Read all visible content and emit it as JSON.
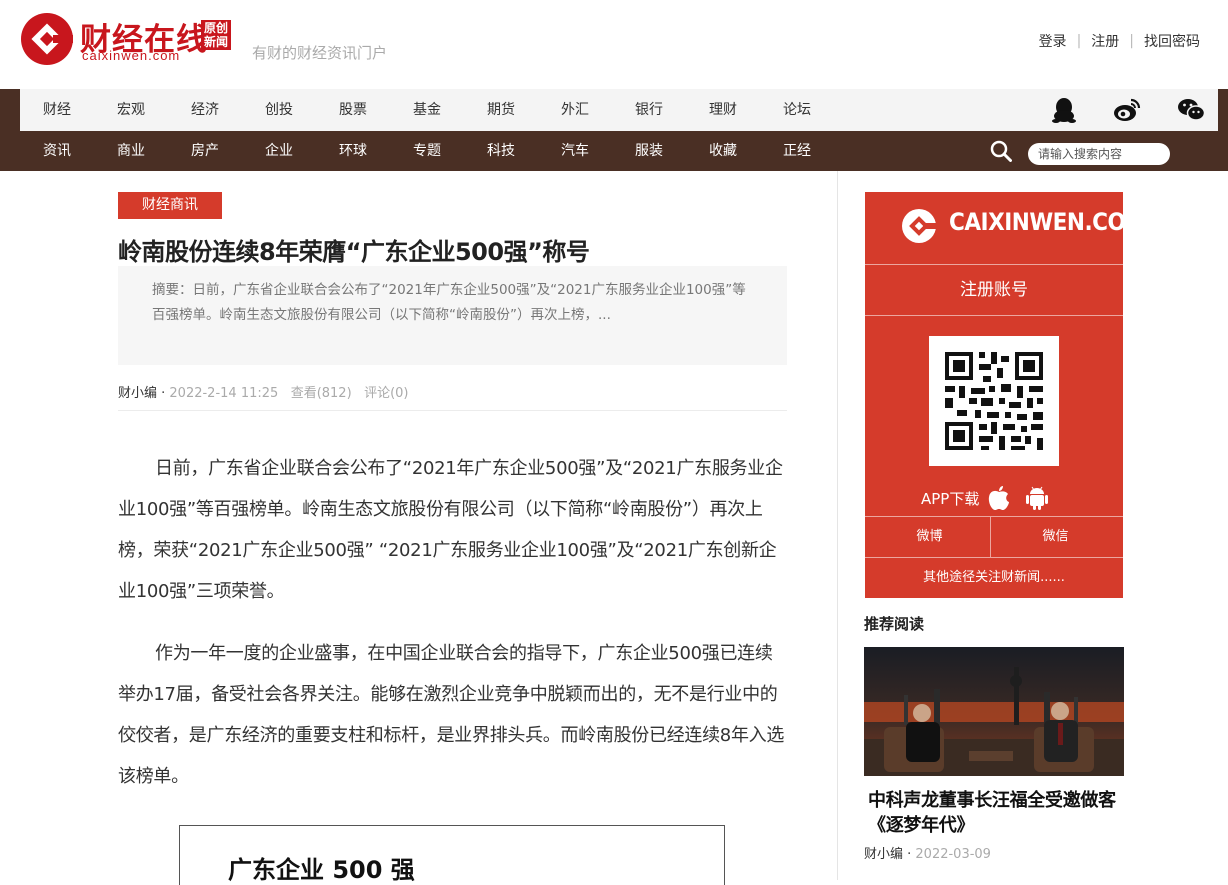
{
  "header": {
    "logo_name": "财经在线",
    "logo_domain": "caixinwen.com",
    "logo_badge": "原创新闻",
    "tagline": "有财的财经资讯门户",
    "links": {
      "login": "登录",
      "register": "注册",
      "recover": "找回密码"
    }
  },
  "nav_primary": [
    "财经",
    "宏观",
    "经济",
    "创投",
    "股票",
    "基金",
    "期货",
    "外汇",
    "银行",
    "理财",
    "论坛"
  ],
  "nav_secondary": [
    "资讯",
    "商业",
    "房产",
    "企业",
    "环球",
    "专题",
    "科技",
    "汽车",
    "服装",
    "收藏",
    "正经"
  ],
  "search": {
    "placeholder": "请输入搜索内容"
  },
  "article": {
    "category": "财经商讯",
    "title": "岭南股份连续8年荣膺“广东企业500强”称号",
    "summary": "摘要：日前，广东省企业联合会公布了“2021年广东企业500强”及“2021广东服务业企业100强”等百强榜单。岭南生态文旅股份有限公司（以下简称“岭南股份”）再次上榜，...",
    "author": "财小编 · ",
    "date": "2022-2-14 11:25",
    "views": "查看(812)",
    "comments": "评论(0)",
    "paragraphs": [
      "日前，广东省企业联合会公布了“2021年广东企业500强”及“2021广东服务业企业100强”等百强榜单。岭南生态文旅股份有限公司（以下简称“岭南股份”）再次上榜，荣获“2021广东企业500强” “2021广东服务业企业100强”及“2021广东创新企业100强”三项荣誉。",
      "作为一年一度的企业盛事，在中国企业联合会的指导下，广东企业500强已连续举办17届，备受社会各界关注。能够在激烈企业竞争中脱颖而出的，无不是行业中的佼佼者，是广东经济的重要支柱和标杆，是业界排头兵。而岭南股份已经连续8年入选该榜单。"
    ],
    "figure_title": "广东企业 500 强"
  },
  "sidebar": {
    "promo_logo": "CAIXINWEN.COM",
    "register_label": "注册账号",
    "app_label": "APP下载",
    "weibo_label": "微博",
    "weixin_label": "微信",
    "other_label": "其他途径关注财新闻......",
    "rec_heading": "推荐阅读",
    "rec_title": "中科声龙董事长汪福全受邀做客《逐梦年代》",
    "rec_author": "财小编 · ",
    "rec_date": "2022-03-09"
  },
  "colors": {
    "brand_red": "#d53b2b",
    "logo_red": "#c8161d",
    "nav_brown": "#4a2f24"
  }
}
